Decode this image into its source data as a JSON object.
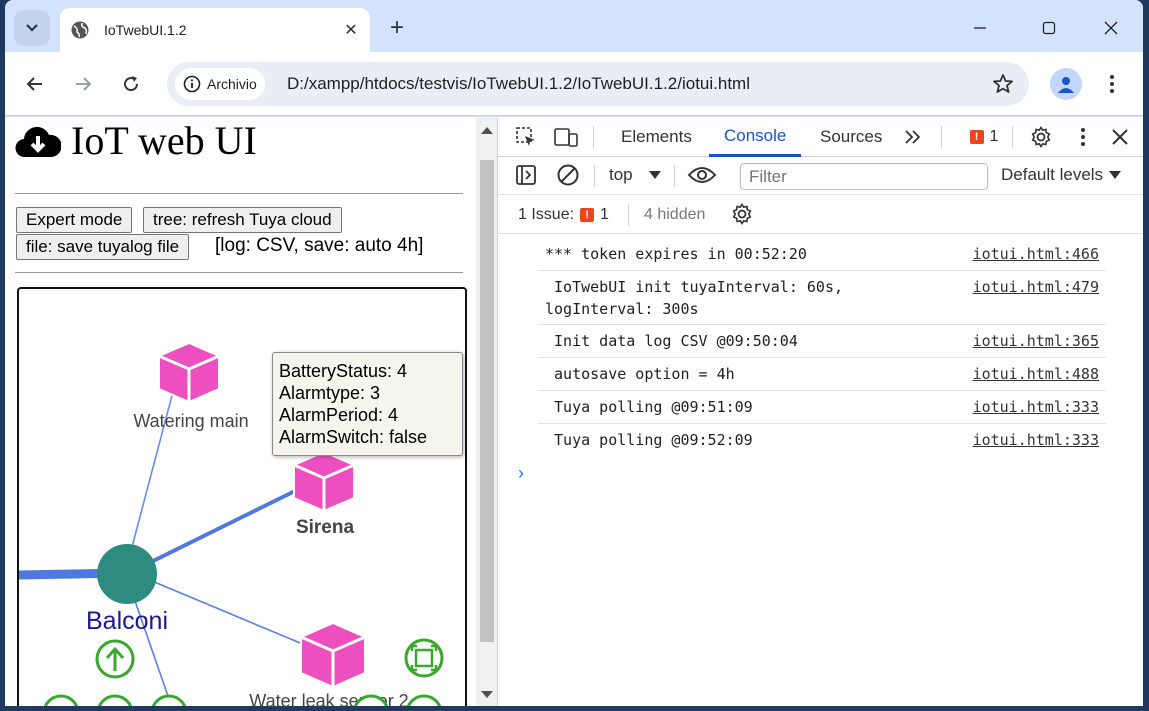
{
  "browser": {
    "tab_title": "IoTwebUI.1.2",
    "tab_close": "✕",
    "new_tab": "+",
    "chip_label": "Archivio",
    "url": "D:/xampp/htdocs/testvis/IoTwebUI.1.2/IoTwebUI.1.2/iotui.html"
  },
  "page": {
    "title": "IoT web UI",
    "buttons": {
      "expert": "Expert mode",
      "refresh": "tree: refresh Tuya cloud",
      "save": "file: save tuyalog file"
    },
    "log_info": "[log: CSV, save: auto 4h]",
    "graph": {
      "nodes": {
        "watering": "Watering main",
        "sirena": "Sirena",
        "balconi": "Balconi",
        "leak": "Water leak sensor 2"
      },
      "tooltip": [
        "BatteryStatus: 4",
        "Alarmtype: 3",
        "AlarmPeriod: 4",
        "AlarmSwitch: false"
      ],
      "colors": {
        "device": "#ee4fc0",
        "hub": "#2e8b80",
        "edge": "#5b80e0",
        "control": "#3aa82e",
        "hub_label": "#1a1a8e"
      }
    }
  },
  "devtools": {
    "tabs": [
      "Elements",
      "Console",
      "Sources"
    ],
    "active_tab": "Console",
    "issue_count": "1",
    "context": "top",
    "filter_placeholder": "Filter",
    "levels": "Default levels",
    "issues_label": "1 Issue:",
    "issues_count": "1",
    "hidden": "4 hidden",
    "logs": [
      {
        "msg": "*** token expires in 00:52:20",
        "src": "iotui.html:466"
      },
      {
        "msg": " IoTwebUI init tuyaInterval: 60s,\nlogInterval: 300s",
        "src": "iotui.html:479"
      },
      {
        "msg": " Init data log CSV @09:50:04",
        "src": "iotui.html:365"
      },
      {
        "msg": " autosave option = 4h",
        "src": "iotui.html:488"
      },
      {
        "msg": " Tuya polling @09:51:09",
        "src": "iotui.html:333"
      },
      {
        "msg": " Tuya polling @09:52:09",
        "src": "iotui.html:333"
      }
    ],
    "prompt": "›"
  }
}
